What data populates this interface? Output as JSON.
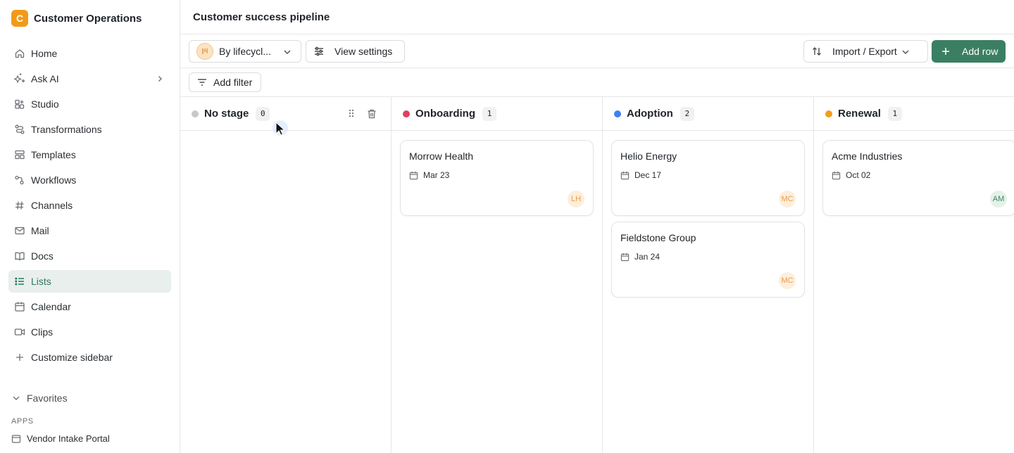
{
  "workspace": {
    "logo_letter": "C",
    "name": "Customer Operations",
    "logo_color": "#f29a18"
  },
  "sidebar": {
    "items": [
      {
        "label": "Home",
        "icon": "home-icon"
      },
      {
        "label": "Ask AI",
        "icon": "sparkle-icon"
      },
      {
        "label": "Studio",
        "icon": "studio-icon"
      },
      {
        "label": "Transformations",
        "icon": "transform-icon"
      },
      {
        "label": "Templates",
        "icon": "template-icon"
      },
      {
        "label": "Workflows",
        "icon": "workflow-icon"
      },
      {
        "label": "Channels",
        "icon": "hash-icon"
      },
      {
        "label": "Mail",
        "icon": "mail-icon"
      },
      {
        "label": "Docs",
        "icon": "book-icon"
      },
      {
        "label": "Lists",
        "icon": "list-icon",
        "active": true
      },
      {
        "label": "Calendar",
        "icon": "calendar-icon"
      },
      {
        "label": "Clips",
        "icon": "video-icon"
      },
      {
        "label": "Customize sidebar",
        "icon": "plus-icon"
      }
    ],
    "favorites_label": "Favorites",
    "apps_label": "APPS",
    "apps": [
      {
        "label": "Vendor Intake Portal",
        "icon": "app-window-icon"
      }
    ]
  },
  "header": {
    "title": "Customer success pipeline"
  },
  "toolbar": {
    "group_label": "By lifecycl...",
    "view_settings_label": "View settings",
    "import_export_label": "Import / Export",
    "add_row_label": "Add row",
    "accent_color": "#3b7f63"
  },
  "filter": {
    "add_filter_label": "Add filter"
  },
  "board": {
    "columns": [
      {
        "title": "No stage",
        "count": "0",
        "color": "#c8c8c8",
        "cards": []
      },
      {
        "title": "Onboarding",
        "count": "1",
        "color": "#e0405e",
        "cards": [
          {
            "title": "Morrow Health",
            "date": "Mar 23",
            "owner": "LH"
          }
        ]
      },
      {
        "title": "Adoption",
        "count": "2",
        "color": "#3b82f6",
        "cards": [
          {
            "title": "Helio Energy",
            "date": "Dec 17",
            "owner": "MC"
          },
          {
            "title": "Fieldstone Group",
            "date": "Jan 24",
            "owner": "MC"
          }
        ]
      },
      {
        "title": "Renewal",
        "count": "1",
        "color": "#eea019",
        "cards": [
          {
            "title": "Acme Industries",
            "date": "Oct 02",
            "owner": "AM"
          }
        ]
      }
    ]
  }
}
